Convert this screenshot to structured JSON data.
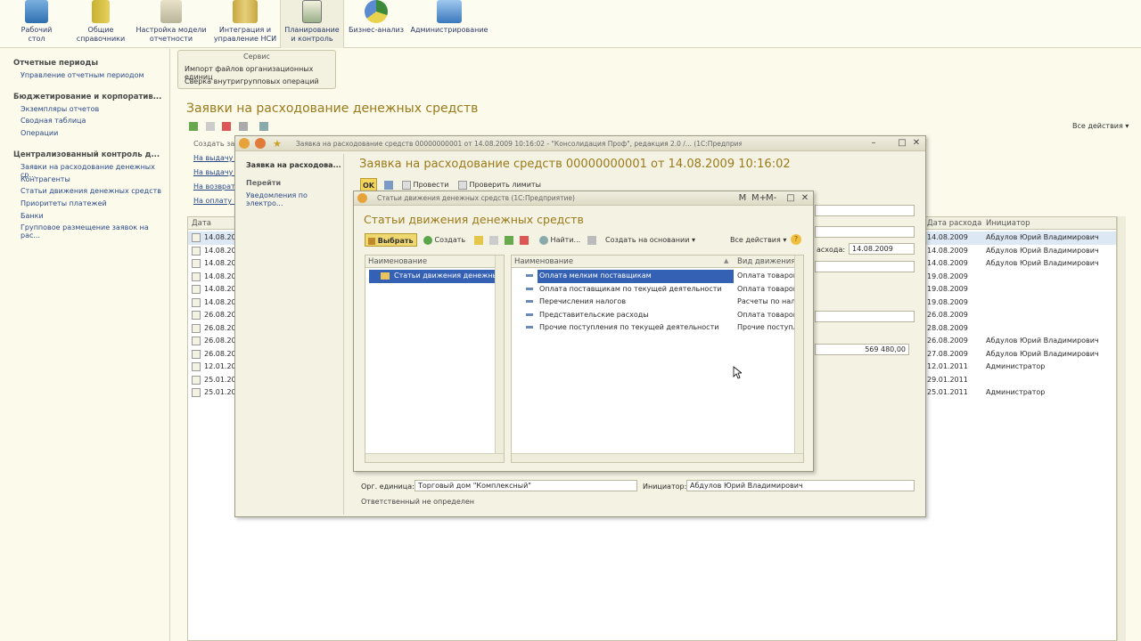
{
  "sections": [
    {
      "label": "Рабочий\nстол",
      "icon": "desktop-icon"
    },
    {
      "label": "Общие\nсправочники",
      "icon": "books-icon"
    },
    {
      "label": "Настройка модели\nотчетности",
      "icon": "report-model-icon"
    },
    {
      "label": "Интеграция и\nуправление НСИ",
      "icon": "database-icon"
    },
    {
      "label": "Планирование\nи контроль",
      "icon": "planning-icon"
    },
    {
      "label": "Бизнес-анализ",
      "icon": "pie-chart-icon"
    },
    {
      "label": "Администрирование",
      "icon": "computer-icon"
    }
  ],
  "service": {
    "title": "Сервис",
    "items": [
      "Импорт файлов организационных единиц",
      "Сверка внутригрупповых операций"
    ]
  },
  "leftnav": {
    "groups": [
      {
        "title": "Отчетные периоды",
        "items": [
          "Управление отчетным периодом"
        ]
      },
      {
        "title": "Бюджетирование и корпоратив...",
        "items": [
          "Экземпляры отчетов",
          "Сводная таблица",
          "Операции"
        ]
      },
      {
        "title": "Централизованный контроль д...",
        "items": [
          "Заявки на расходование денежных ср...",
          "Контрагенты",
          "Статьи движения денежных средств",
          "Приоритеты платежей",
          "Банки",
          "Групповое размещение заявок на рас..."
        ]
      }
    ]
  },
  "main": {
    "title": "Заявки на расходование денежных средств",
    "all_actions": "Все действия ▾",
    "create_group": "Создать за",
    "create_links": [
      "На выдачу д",
      "На выдачу Д",
      "На возврат",
      "На оплату п"
    ],
    "col_date": "Дата",
    "col_date_expense": "Дата расхода",
    "col_initiator": "Инициатор",
    "rows": [
      {
        "date": "14.08.200",
        "date_expense": "14.08.2009",
        "initiator": "Абдулов Юрий Владимирович"
      },
      {
        "date": "14.08.200",
        "date_expense": "14.08.2009",
        "initiator": "Абдулов Юрий Владимирович"
      },
      {
        "date": "14.08.200",
        "date_expense": "14.08.2009",
        "initiator": "Абдулов Юрий Владимирович"
      },
      {
        "date": "14.08.200",
        "date_expense": "19.08.2009",
        "initiator": ""
      },
      {
        "date": "14.08.200",
        "date_expense": "19.08.2009",
        "initiator": ""
      },
      {
        "date": "14.08.200",
        "date_expense": "19.08.2009",
        "initiator": ""
      },
      {
        "date": "26.08.200",
        "date_expense": "26.08.2009",
        "initiator": ""
      },
      {
        "date": "26.08.200",
        "date_expense": "28.08.2009",
        "initiator": ""
      },
      {
        "date": "26.08.200",
        "date_expense": "26.08.2009",
        "initiator": "Абдулов Юрий Владимирович"
      },
      {
        "date": "26.08.200",
        "date_expense": "27.08.2009",
        "initiator": "Абдулов Юрий Владимирович"
      },
      {
        "date": "12.01.201",
        "date_expense": "12.01.2011",
        "initiator": "Администратор"
      },
      {
        "date": "25.01.201",
        "date_expense": "29.01.2011",
        "initiator": ""
      },
      {
        "date": "25.01.201",
        "date_expense": "25.01.2011",
        "initiator": "Администратор"
      }
    ]
  },
  "doc_window": {
    "title": "Заявка на расходование средств 00000000001 от 14.08.2009 10:16:02 - \"Консолидация Проф\", редакция 2.0 /...  (1С:Предприятие)",
    "nav_current": "Заявка на расходова...",
    "nav_goto": "Перейти",
    "nav_link": "Уведомления по электро...",
    "heading": "Заявка на расходование средств 00000000001 от 14.08.2009 10:16:02",
    "ok": "OK",
    "post": "Провести",
    "check_limits": "Проверить лимиты",
    "date_label": "асхода:",
    "date_value": "14.08.2009",
    "amount": "569 480,00",
    "org_label": "Орг. единица:",
    "org_value": "Торговый дом \"Комплексный\"",
    "initiator_label": "Инициатор:",
    "initiator_value": "Абдулов Юрий Владимирович",
    "responsible": "Ответственный не определен"
  },
  "select_window": {
    "title": "Статьи движения денежных средств  (1С:Предприятие)",
    "heading": "Статьи движения денежных средств",
    "choose": "Выбрать",
    "create": "Создать",
    "find": "Найти...",
    "create_based": "Создать на основании ▾",
    "all_actions": "Все действия ▾",
    "tree_col": "Наименование",
    "tree_root": "Статьи движения денежнь",
    "list_col_name": "Наименование",
    "list_col_kind": "Вид движения д",
    "items": [
      {
        "name": "Оплата мелким поставщикам",
        "kind": "Оплата товаров"
      },
      {
        "name": "Оплата поставщикам по текущей деятельности",
        "kind": "Оплата товаров"
      },
      {
        "name": "Перечисления налогов",
        "kind": "Расчеты по нал"
      },
      {
        "name": "Представительские расходы",
        "kind": "Оплата товаров"
      },
      {
        "name": "Прочие поступления по текущей деятельности",
        "kind": "Прочие поступл"
      }
    ],
    "ctrl_labels": [
      "M",
      "M+",
      "M-"
    ]
  },
  "colors": {
    "title_gold": "#9a7a1a",
    "link_blue": "#2a4a8a",
    "selection": "#3561b5"
  }
}
